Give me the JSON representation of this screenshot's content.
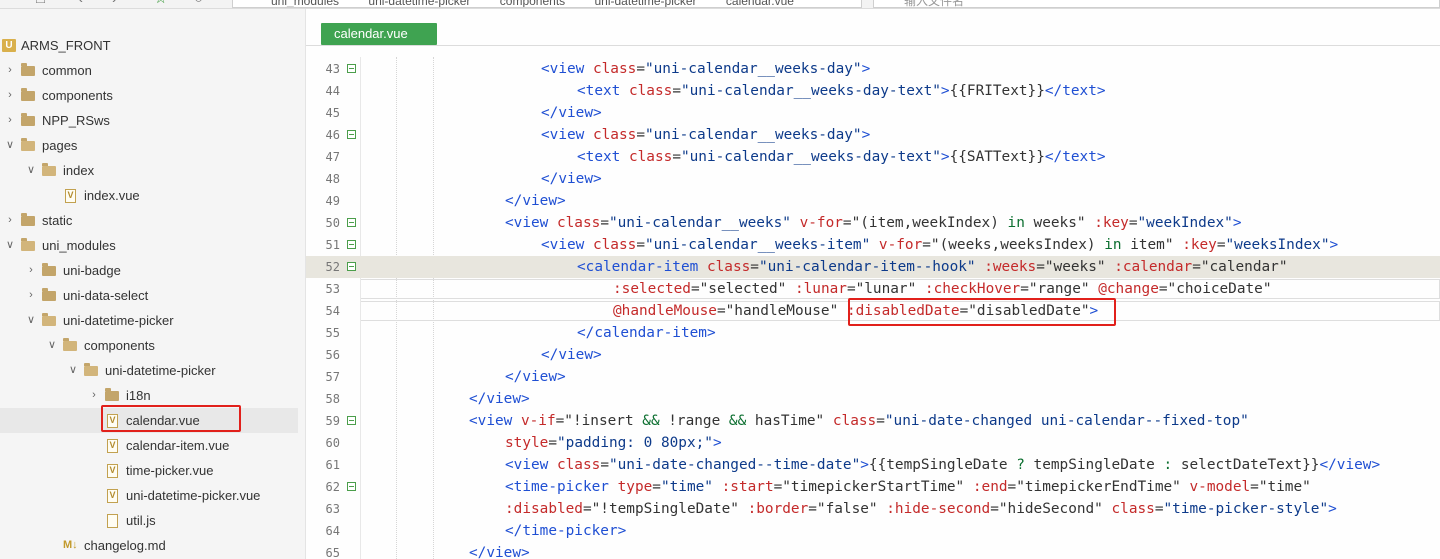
{
  "breadcrumb": [
    "uni_modules",
    "uni-datetime-picker",
    "components",
    "uni-datetime-picker",
    "calendar.vue"
  ],
  "search": {
    "placeholder": "输入文件名"
  },
  "sidebar": {
    "project": "ARMS_FRONT",
    "items": [
      {
        "label": "common",
        "type": "folder",
        "expanded": false
      },
      {
        "label": "components",
        "type": "folder",
        "expanded": false
      },
      {
        "label": "NPP_RSws",
        "type": "folder",
        "expanded": false
      },
      {
        "label": "pages",
        "type": "folder",
        "expanded": true
      },
      {
        "label": "index",
        "type": "folder",
        "expanded": true
      },
      {
        "label": "index.vue",
        "type": "vue"
      },
      {
        "label": "static",
        "type": "folder",
        "expanded": false
      },
      {
        "label": "uni_modules",
        "type": "folder",
        "expanded": true
      },
      {
        "label": "uni-badge",
        "type": "folder",
        "expanded": false
      },
      {
        "label": "uni-data-select",
        "type": "folder",
        "expanded": false
      },
      {
        "label": "uni-datetime-picker",
        "type": "folder",
        "expanded": true
      },
      {
        "label": "components",
        "type": "folder",
        "expanded": true
      },
      {
        "label": "uni-datetime-picker",
        "type": "folder",
        "expanded": true
      },
      {
        "label": "i18n",
        "type": "folder",
        "expanded": false
      },
      {
        "label": "calendar.vue",
        "type": "vue",
        "selected": true
      },
      {
        "label": "calendar-item.vue",
        "type": "vue"
      },
      {
        "label": "time-picker.vue",
        "type": "vue"
      },
      {
        "label": "uni-datetime-picker.vue",
        "type": "vue"
      },
      {
        "label": "util.js",
        "type": "js"
      },
      {
        "label": "changelog.md",
        "type": "md"
      }
    ]
  },
  "editor": {
    "tab_label": "calendar.vue",
    "current_line": 52,
    "lines": [
      {
        "n": "43",
        "fold": true,
        "tokens": [
          [
            "tag",
            "<view "
          ],
          [
            "attr",
            "class"
          ],
          [
            "p",
            "="
          ],
          [
            "str",
            "\"uni-calendar__weeks-day\""
          ],
          [
            "tag",
            ">"
          ]
        ]
      },
      {
        "n": "44",
        "fold": false,
        "tokens": [
          [
            "tag",
            "<text "
          ],
          [
            "attr",
            "class"
          ],
          [
            "p",
            "="
          ],
          [
            "str",
            "\"uni-calendar__weeks-day-text\""
          ],
          [
            "tag",
            ">"
          ],
          [
            "p",
            "{{FRIText}}"
          ],
          [
            "tag",
            "</text>"
          ]
        ]
      },
      {
        "n": "45",
        "fold": false,
        "tokens": [
          [
            "tag",
            "</view>"
          ]
        ]
      },
      {
        "n": "46",
        "fold": true,
        "tokens": [
          [
            "tag",
            "<view "
          ],
          [
            "attr",
            "class"
          ],
          [
            "p",
            "="
          ],
          [
            "str",
            "\"uni-calendar__weeks-day\""
          ],
          [
            "tag",
            ">"
          ]
        ]
      },
      {
        "n": "47",
        "fold": false,
        "tokens": [
          [
            "tag",
            "<text "
          ],
          [
            "attr",
            "class"
          ],
          [
            "p",
            "="
          ],
          [
            "str",
            "\"uni-calendar__weeks-day-text\""
          ],
          [
            "tag",
            ">"
          ],
          [
            "p",
            "{{SATText}}"
          ],
          [
            "tag",
            "</text>"
          ]
        ]
      },
      {
        "n": "48",
        "fold": false,
        "tokens": [
          [
            "tag",
            "</view>"
          ]
        ]
      },
      {
        "n": "49",
        "fold": false,
        "tokens": [
          [
            "tag",
            "</view>"
          ]
        ]
      },
      {
        "n": "50",
        "fold": true,
        "tokens": [
          [
            "tag",
            "<view "
          ],
          [
            "attr",
            "class"
          ],
          [
            "p",
            "="
          ],
          [
            "str",
            "\"uni-calendar__weeks\" "
          ],
          [
            "attr",
            "v-for"
          ],
          [
            "p",
            "=\"(item,weekIndex) "
          ],
          [
            "kw",
            "in"
          ],
          [
            "p",
            " weeks\" "
          ],
          [
            "attr",
            ":key"
          ],
          [
            "p",
            "="
          ],
          [
            "str",
            "\"weekIndex\""
          ],
          [
            "tag",
            ">"
          ]
        ]
      },
      {
        "n": "51",
        "fold": true,
        "tokens": [
          [
            "tag",
            "<view "
          ],
          [
            "attr",
            "class"
          ],
          [
            "p",
            "="
          ],
          [
            "str",
            "\"uni-calendar__weeks-item\" "
          ],
          [
            "attr",
            "v-for"
          ],
          [
            "p",
            "=\"(weeks,weeksIndex) "
          ],
          [
            "kw",
            "in"
          ],
          [
            "p",
            " item\" "
          ],
          [
            "attr",
            ":key"
          ],
          [
            "p",
            "="
          ],
          [
            "str",
            "\"weeksIndex\""
          ],
          [
            "tag",
            ">"
          ]
        ]
      },
      {
        "n": "52",
        "fold": true,
        "tokens": [
          [
            "tag",
            "<calendar-item "
          ],
          [
            "attr",
            "class"
          ],
          [
            "p",
            "="
          ],
          [
            "str",
            "\"uni-calendar-item--hook\" "
          ],
          [
            "attr",
            ":weeks"
          ],
          [
            "p",
            "=\"weeks\" "
          ],
          [
            "attr",
            ":calendar"
          ],
          [
            "p",
            "=\"calendar\""
          ]
        ]
      },
      {
        "n": "53",
        "fold": false,
        "tokens": [
          [
            "attr",
            ":selected"
          ],
          [
            "p",
            "=\"selected\" "
          ],
          [
            "attr",
            ":lunar"
          ],
          [
            "p",
            "=\"lunar\" "
          ],
          [
            "attr",
            ":checkHover"
          ],
          [
            "p",
            "=\"range\" "
          ],
          [
            "attr",
            "@change"
          ],
          [
            "p",
            "=\"choiceDate\""
          ]
        ]
      },
      {
        "n": "54",
        "fold": false,
        "tokens": [
          [
            "attr",
            "@handleMouse"
          ],
          [
            "p",
            "=\"handleMouse\" "
          ],
          [
            "attr",
            ":disabledDate"
          ],
          [
            "p",
            "=\"disabledDate\""
          ],
          [
            "tag",
            ">"
          ]
        ]
      },
      {
        "n": "55",
        "fold": false,
        "tokens": [
          [
            "tag",
            "</calendar-item>"
          ]
        ]
      },
      {
        "n": "56",
        "fold": false,
        "tokens": [
          [
            "tag",
            "</view>"
          ]
        ]
      },
      {
        "n": "57",
        "fold": false,
        "tokens": [
          [
            "tag",
            "</view>"
          ]
        ]
      },
      {
        "n": "58",
        "fold": false,
        "tokens": [
          [
            "tag",
            "</view>"
          ]
        ]
      },
      {
        "n": "59",
        "fold": true,
        "tokens": [
          [
            "tag",
            "<view "
          ],
          [
            "attr",
            "v-if"
          ],
          [
            "p",
            "=\"!insert "
          ],
          [
            "kw",
            "&&"
          ],
          [
            "p",
            " !range "
          ],
          [
            "kw",
            "&&"
          ],
          [
            "p",
            " hasTime\" "
          ],
          [
            "attr",
            "class"
          ],
          [
            "p",
            "="
          ],
          [
            "str",
            "\"uni-date-changed uni-calendar--fixed-top\""
          ]
        ]
      },
      {
        "n": "60",
        "fold": false,
        "tokens": [
          [
            "attr",
            "style"
          ],
          [
            "p",
            "="
          ],
          [
            "str",
            "\"padding: 0 80px;\""
          ],
          [
            "tag",
            ">"
          ]
        ]
      },
      {
        "n": "61",
        "fold": false,
        "tokens": [
          [
            "tag",
            "<view "
          ],
          [
            "attr",
            "class"
          ],
          [
            "p",
            "="
          ],
          [
            "str",
            "\"uni-date-changed--time-date\""
          ],
          [
            "tag",
            ">"
          ],
          [
            "p",
            "{{tempSingleDate "
          ],
          [
            "kw",
            "?"
          ],
          [
            "p",
            " tempSingleDate "
          ],
          [
            "kw",
            ":"
          ],
          [
            "p",
            " selectDateText}}"
          ],
          [
            "tag",
            "</view>"
          ]
        ]
      },
      {
        "n": "62",
        "fold": true,
        "tokens": [
          [
            "tag",
            "<time-picker "
          ],
          [
            "attr",
            "type"
          ],
          [
            "p",
            "="
          ],
          [
            "str",
            "\"time\" "
          ],
          [
            "attr",
            ":start"
          ],
          [
            "p",
            "=\"timepickerStartTime\" "
          ],
          [
            "attr",
            ":end"
          ],
          [
            "p",
            "=\"timepickerEndTime\" "
          ],
          [
            "attr",
            "v-model"
          ],
          [
            "p",
            "=\"time\""
          ]
        ]
      },
      {
        "n": "63",
        "fold": false,
        "tokens": [
          [
            "attr",
            ":disabled"
          ],
          [
            "p",
            "=\"!tempSingleDate\" "
          ],
          [
            "attr",
            ":border"
          ],
          [
            "p",
            "=\"false\" "
          ],
          [
            "attr",
            ":hide-second"
          ],
          [
            "p",
            "=\"hideSecond\" "
          ],
          [
            "attr",
            "class"
          ],
          [
            "p",
            "="
          ],
          [
            "str",
            "\"time-picker-style\""
          ],
          [
            "tag",
            ">"
          ]
        ]
      },
      {
        "n": "64",
        "fold": false,
        "tokens": [
          [
            "tag",
            "</time-picker>"
          ]
        ]
      },
      {
        "n": "65",
        "fold": false,
        "tokens": [
          [
            "tag",
            "</view>"
          ]
        ]
      }
    ]
  },
  "colors": {
    "tab_bg": "#3fa351",
    "highlight_box": "#e1201b",
    "tag": "#1f4fd3",
    "attr": "#c42a2a",
    "keyword": "#0b6e2f"
  }
}
